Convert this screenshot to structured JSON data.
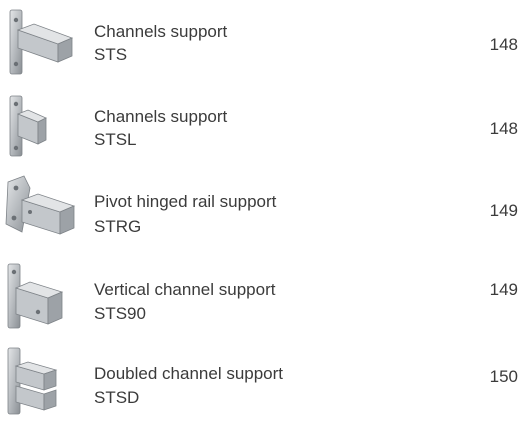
{
  "items": [
    {
      "name": "Channels support",
      "code": "STS",
      "page": "148",
      "icon": "channel-support-icon"
    },
    {
      "name": "Channels support",
      "code": "STSL",
      "page": "148",
      "icon": "channel-support-long-icon"
    },
    {
      "name": "Pivot hinged rail support",
      "code": "STRG",
      "page": "149",
      "icon": "pivot-hinged-support-icon"
    },
    {
      "name": "Vertical channel support",
      "code": "STS90",
      "page": "149",
      "icon": "vertical-channel-support-icon"
    },
    {
      "name": "Doubled channel support",
      "code": "STSD",
      "page": "150",
      "icon": "doubled-channel-support-icon"
    }
  ],
  "colors": {
    "text": "#3b3b3b",
    "metal_light": "#d4d7da",
    "metal_mid": "#a9adb1",
    "metal_dark": "#7e8388"
  }
}
